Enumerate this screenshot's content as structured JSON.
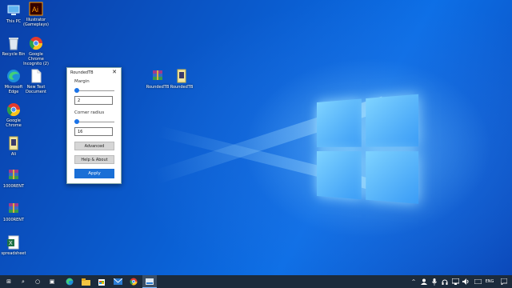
{
  "desktop": {
    "icons": [
      {
        "label": "This PC",
        "icon": "this-pc-icon"
      },
      {
        "label": "Illustrator (Gameplays)",
        "icon": "adobe-illustrator-icon"
      },
      {
        "label": "Recycle Bin",
        "icon": "recycle-bin-icon"
      },
      {
        "label": "Google Chrome Incognito (2)",
        "icon": "chrome-icon"
      },
      {
        "label": "Microsoft Edge",
        "icon": "edge-icon"
      },
      {
        "label": "New Text Document",
        "icon": "text-document-icon"
      },
      {
        "label": "Google Chrome",
        "icon": "chrome-icon"
      },
      {
        "label": "Ali",
        "icon": "file-icon"
      },
      {
        "label": "1000RENT",
        "icon": "winrar-archive-icon"
      },
      {
        "label": "1000RENT",
        "icon": "winrar-archive-icon"
      },
      {
        "label": "spreadsheet",
        "icon": "excel-icon"
      },
      {
        "label": "RoundedTB",
        "icon": "winrar-archive-icon"
      },
      {
        "label": "RoundedTB",
        "icon": "file-icon"
      }
    ]
  },
  "dialog": {
    "title": "RoundedTB",
    "close_glyph": "✕",
    "margin_label": "Margin",
    "margin_value": "2",
    "margin_slider_fraction": 0.0,
    "radius_label": "Corner radius",
    "radius_value": "16",
    "radius_slider_fraction": 0.0,
    "advanced_label": "Advanced",
    "help_label": "Help & About",
    "apply_label": "Apply"
  },
  "taskbar": {
    "start": "⊞",
    "search": "⌕",
    "cortana": "○",
    "taskview": "▣",
    "tray_expand": "^",
    "language": "ENG"
  },
  "colors": {
    "accent": "#1a6fd6",
    "taskbar": "#1c2b3c"
  }
}
